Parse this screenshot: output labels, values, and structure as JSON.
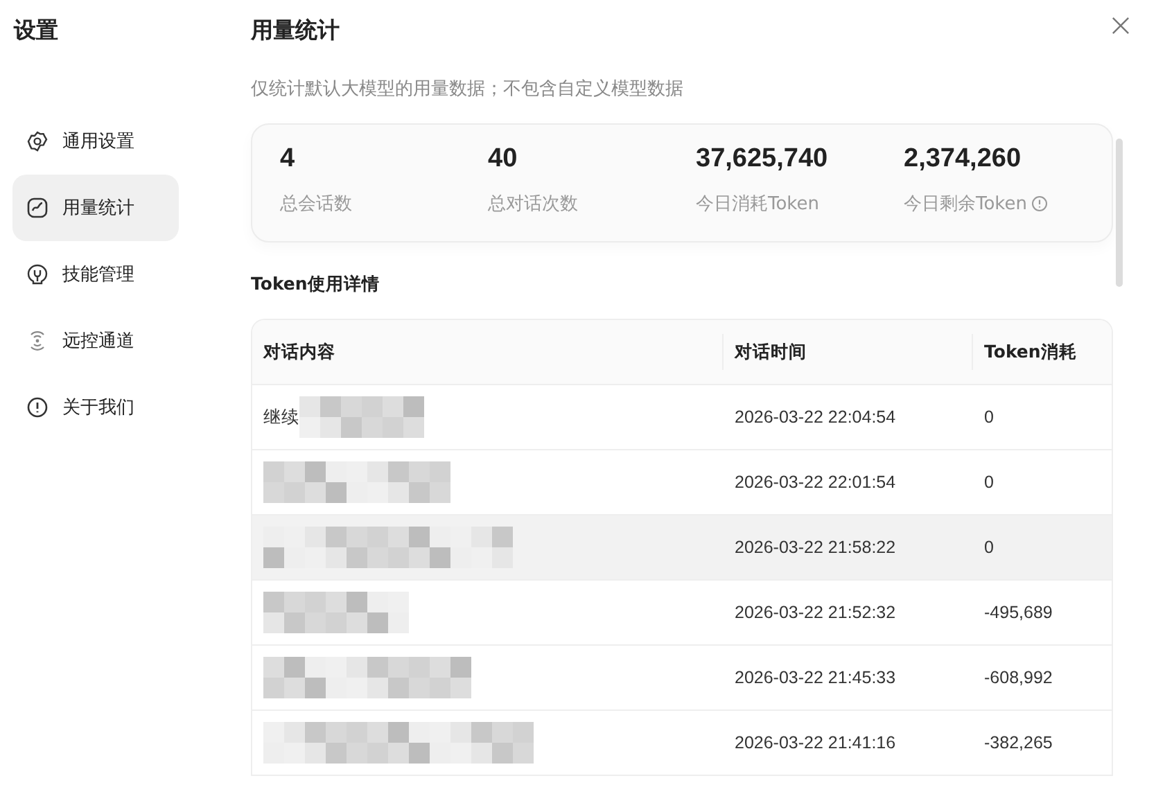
{
  "sidebar": {
    "title": "设置",
    "items": [
      {
        "label": "通用设置",
        "selected": false
      },
      {
        "label": "用量统计",
        "selected": true
      },
      {
        "label": "技能管理",
        "selected": false
      },
      {
        "label": "远控通道",
        "selected": false
      },
      {
        "label": "关于我们",
        "selected": false
      }
    ]
  },
  "main": {
    "title": "用量统计",
    "subtitle": "仅统计默认大模型的用量数据；不包含自定义模型数据",
    "stats": [
      {
        "value": "4",
        "label": "总会话数",
        "info": false
      },
      {
        "value": "40",
        "label": "总对话次数",
        "info": false
      },
      {
        "value": "37,625,740",
        "label": "今日消耗Token",
        "info": false
      },
      {
        "value": "2,374,260",
        "label": "今日剩余Token",
        "info": true
      }
    ],
    "section_title": "Token使用详情",
    "table": {
      "columns": [
        "对话内容",
        "对话时间",
        "Token消耗"
      ],
      "rows": [
        {
          "content": "继续",
          "redacted": true,
          "time": "2026-03-22 22:04:54",
          "tokens": "0",
          "hovered": false
        },
        {
          "redacted": true,
          "time": "2026-03-22 22:01:54",
          "tokens": "0",
          "hovered": false
        },
        {
          "redacted": true,
          "time": "2026-03-22 21:58:22",
          "tokens": "0",
          "hovered": true
        },
        {
          "redacted": true,
          "time": "2026-03-22 21:52:32",
          "tokens": "-495,689",
          "hovered": false
        },
        {
          "redacted": true,
          "time": "2026-03-22 21:45:33",
          "tokens": "-608,992",
          "hovered": false
        },
        {
          "redacted": true,
          "time": "2026-03-22 21:41:16",
          "tokens": "-382,265",
          "hovered": false
        }
      ]
    }
  }
}
